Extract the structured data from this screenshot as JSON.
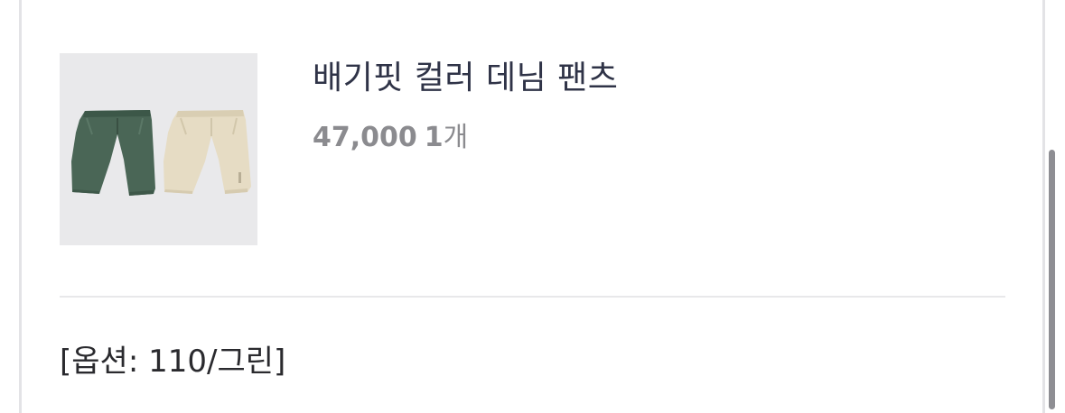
{
  "product": {
    "name": "배기핏 컬러 데님 팬츠",
    "price": "47,000",
    "quantity": "1",
    "quantity_unit": "개",
    "image_icon": "product-thumbnail",
    "pant_colors": [
      "#4a6656",
      "#e6dcc4"
    ]
  },
  "option": {
    "text": "[옵션: 110/그린]"
  }
}
